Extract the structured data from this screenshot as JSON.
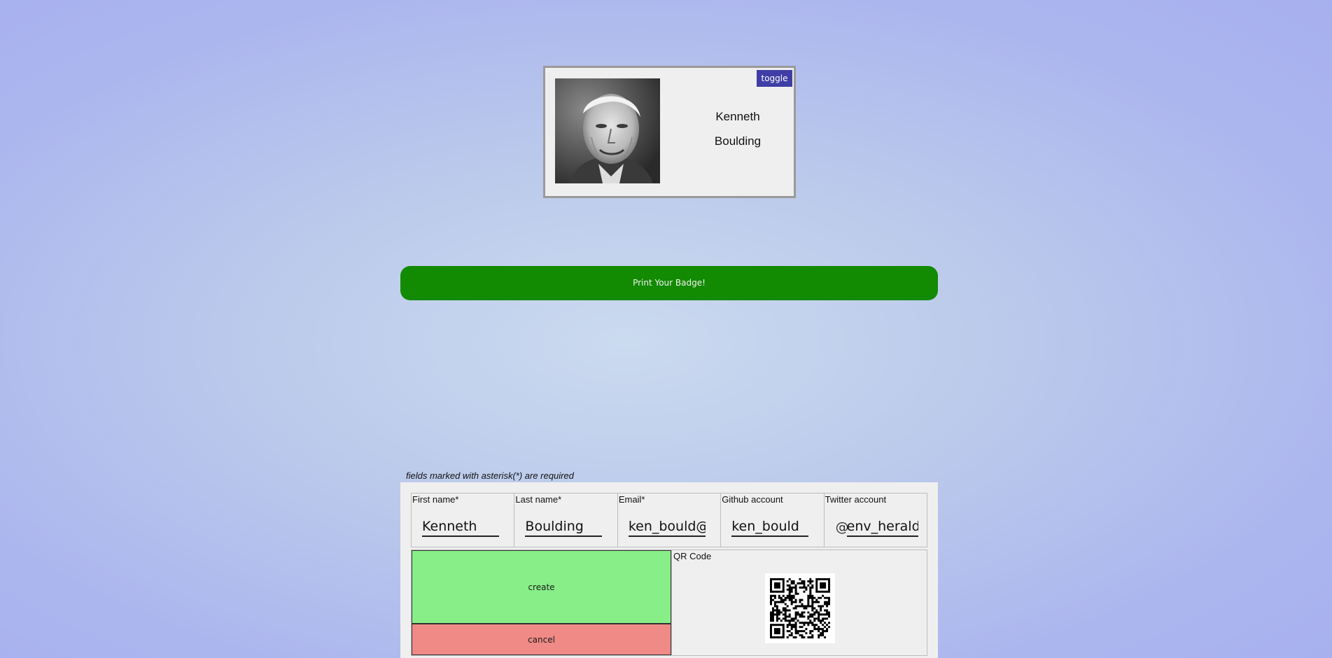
{
  "badge": {
    "toggle_label": "toggle",
    "first_name": "Kenneth",
    "last_name": "Boulding",
    "photo": "portrait-photo"
  },
  "print_button": {
    "label": "Print Your Badge!"
  },
  "form": {
    "required_note": "fields marked with asterisk(*) are required",
    "fields": {
      "first_name": {
        "label": "First name*",
        "value": "Kenneth"
      },
      "last_name": {
        "label": "Last name*",
        "value": "Boulding"
      },
      "email": {
        "label": "Email*",
        "value": "ken_bould@"
      },
      "github": {
        "label": "Github account",
        "value": "ken_bould"
      },
      "twitter": {
        "label": "Twitter account",
        "prefix": "@",
        "value": "env_herald"
      }
    },
    "create_label": "create",
    "cancel_label": "cancel",
    "qr_label": "QR Code"
  },
  "colors": {
    "toggle": "#3f3ea6",
    "print_button": "#128a01",
    "create": "#88ee88",
    "cancel": "#f08a86"
  }
}
